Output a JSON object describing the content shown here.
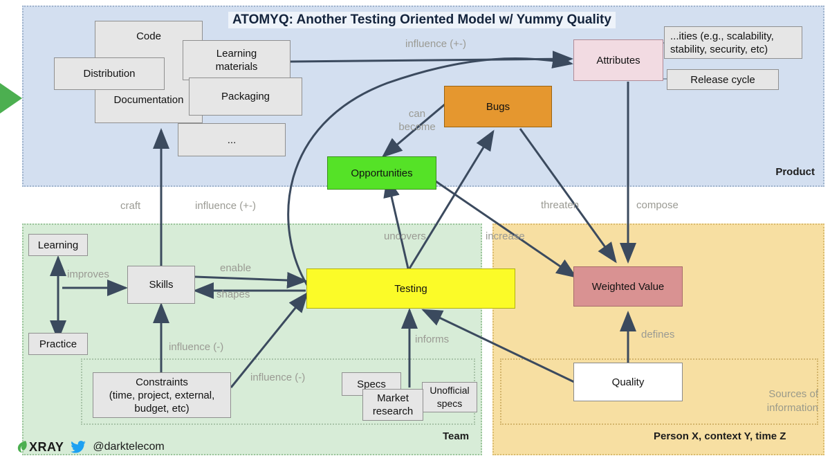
{
  "title": "ATOMYQ: Another Testing Oriented Model w/ Yummy Quality",
  "panels": {
    "product": {
      "label": "Product",
      "color": "#d3dff0"
    },
    "team": {
      "label": "Team",
      "color": "#d7ecd7"
    },
    "person": {
      "label": "Person X, context Y, time Z",
      "color": "#f7dfa2"
    },
    "sources": {
      "label": "Sources of\ninformation"
    }
  },
  "nodes": {
    "code": {
      "label": "Code",
      "color": "#e6e6e6"
    },
    "distribution": {
      "label": "Distribution",
      "color": "#e6e6e6"
    },
    "learning_materials": {
      "label": "Learning\nmaterials",
      "color": "#e6e6e6"
    },
    "packaging": {
      "label": "Packaging",
      "color": "#e6e6e6"
    },
    "documentation": {
      "label": "Documentation",
      "color": "#e6e6e6"
    },
    "ellipsis": {
      "label": "...",
      "color": "#e6e6e6"
    },
    "attributes": {
      "label": "Attributes",
      "color": "#f2dbe2"
    },
    "ilities": {
      "label": "...ities (e.g., scalability, stability, security, etc)",
      "color": "#e6e6e6"
    },
    "release_cycle": {
      "label": "Release cycle",
      "color": "#e6e6e6"
    },
    "bugs": {
      "label": "Bugs",
      "color": "#e5972f"
    },
    "opportunities": {
      "label": "Opportunities",
      "color": "#55e227"
    },
    "learning": {
      "label": "Learning",
      "color": "#e6e6e6"
    },
    "practice": {
      "label": "Practice",
      "color": "#e6e6e6"
    },
    "skills": {
      "label": "Skills",
      "color": "#e6e6e6"
    },
    "testing": {
      "label": "Testing",
      "color": "#fbfb28"
    },
    "constraints": {
      "label": "Constraints\n(time, project, external,\nbudget, etc)",
      "color": "#e6e6e6"
    },
    "specs": {
      "label": "Specs",
      "color": "#e6e6e6"
    },
    "market_research": {
      "label": "Market\nresearch",
      "color": "#e6e6e6"
    },
    "unofficial_specs": {
      "label": "Unofficial\nspecs",
      "color": "#e6e6e6"
    },
    "weighted_value": {
      "label": "Weighted Value",
      "color": "#d99292"
    },
    "quality": {
      "label": "Quality",
      "color": "#ffffff"
    }
  },
  "edge_labels": {
    "influence_top": "influence (+-)",
    "can_become": "can\nbecome",
    "craft": "craft",
    "influence_mid": "influence (+-)",
    "threaten": "threaten",
    "compose": "compose",
    "uncovers": "uncovers",
    "increase": "increase",
    "improves": "improves",
    "enable": "enable",
    "shapes": "shapes",
    "influence_neg_1": "influence (-)",
    "influence_neg_2": "influence (-)",
    "informs": "informs",
    "defines": "defines"
  },
  "footer": {
    "brand": "XRAY",
    "handle": "@darktelecom"
  },
  "colors": {
    "arrow": "#3b4a5e",
    "label_text": "#9a9a93",
    "title_text": "#14243d",
    "pointer_green": "#4caf50",
    "twitter_blue": "#1da1f2",
    "xray_green": "#4caf50"
  }
}
